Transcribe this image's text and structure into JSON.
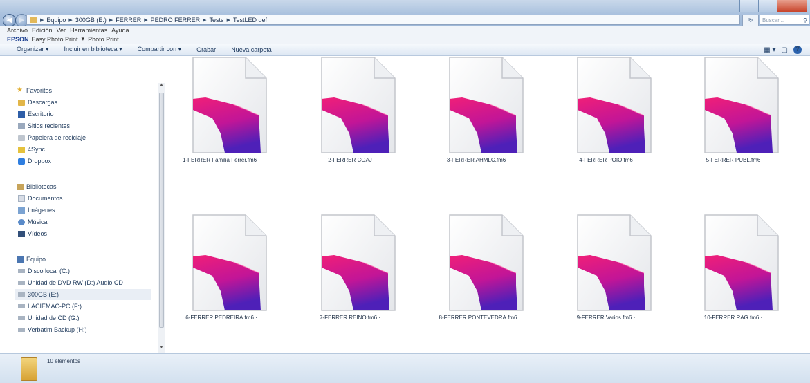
{
  "address_bar": {
    "crumbs": [
      "Equipo",
      "300GB (E:)",
      "FERRER",
      "PEDRO FERRER",
      "Tests",
      "TestLED def"
    ],
    "search_placeholder": "Buscar..."
  },
  "menubar": [
    "Archivo",
    "Edición",
    "Ver",
    "Herramientas",
    "Ayuda"
  ],
  "epsonbar": {
    "logo": "EPSON",
    "items": [
      "Easy Photo Print",
      "Photo Print"
    ]
  },
  "toolbar": {
    "organize": "Organizar ▾",
    "include": "Incluir en biblioteca ▾",
    "share": "Compartir con ▾",
    "burn": "Grabar",
    "new_folder": "Nueva carpeta"
  },
  "sidebar": {
    "favorites": {
      "title": "Favoritos",
      "items": [
        "Descargas",
        "Escritorio",
        "Sitios recientes",
        "Papelera de reciclaje",
        "4Sync",
        "Dropbox"
      ]
    },
    "libraries": {
      "title": "Bibliotecas",
      "items": [
        "Documentos",
        "Imágenes",
        "Música",
        "Vídeos"
      ]
    },
    "computer": {
      "title": "Equipo",
      "items": [
        "Disco local (C:)",
        "Unidad de DVD RW (D:) Audio CD",
        "300GB (E:)",
        "LACIEMAC-PC (F:)",
        "Unidad de CD (G:)",
        "Verbatim Backup (H:)"
      ]
    }
  },
  "files": [
    {
      "name": "1-FERRER Familia Ferrer.fm6 ·"
    },
    {
      "name": "2-FERRER COAJ"
    },
    {
      "name": "3-FERRER AHMLC.fm6 ·"
    },
    {
      "name": "4-FERRER POIO.fm6"
    },
    {
      "name": "5-FERRER PUBL.fm6"
    },
    {
      "name": "6-FERRER PEDREIRA.fm6 ·"
    },
    {
      "name": "7-FERRER REINO.fm6 ·"
    },
    {
      "name": "8-FERRER PONTEVEDRA.fm6"
    },
    {
      "name": "9-FERRER Varios.fm6 ·"
    },
    {
      "name": "10-FERRER RAG.fm6 ·"
    }
  ],
  "status": {
    "count": "10 elementos"
  },
  "colors": {
    "accent_pink": "#e8197a",
    "accent_purple": "#5a1fb3",
    "titlebar": "#a9c1de"
  }
}
